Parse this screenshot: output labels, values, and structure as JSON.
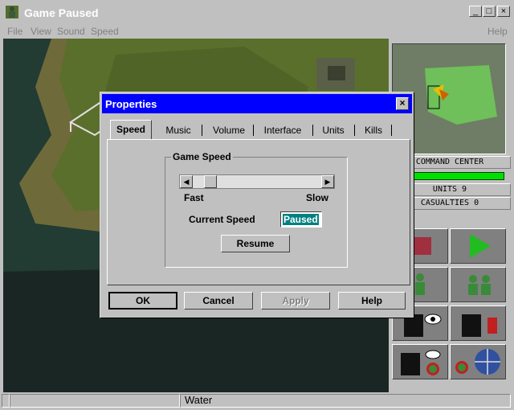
{
  "window": {
    "title": "Game Paused",
    "controls": {
      "minimize": "_",
      "maximize": "□",
      "close": "×"
    }
  },
  "menu": {
    "items": [
      "File",
      "View",
      "Sound",
      "Speed"
    ],
    "help": "Help"
  },
  "dialog": {
    "title": "Properties",
    "close": "×",
    "tabs": [
      "Speed",
      "Music",
      "Volume",
      "Interface",
      "Units",
      "Kills"
    ],
    "active_tab": "Speed",
    "group_title": "Game Speed",
    "slider": {
      "left_label": "Fast",
      "right_label": "Slow",
      "left_arrow": "◀",
      "right_arrow": "▶",
      "position": 0.1
    },
    "current_speed_label": "Current Speed",
    "current_speed_value": "Paused",
    "resume_label": "Resume",
    "buttons": {
      "ok": "OK",
      "cancel": "Cancel",
      "apply": "Apply",
      "help": "Help"
    }
  },
  "side_panel": {
    "command_center": "COMMAND CENTER",
    "units": "UNITS 9",
    "casualties": "CASUALTIES 0"
  },
  "status_bar": {
    "terrain": "Water"
  },
  "colors": {
    "dialog_title": "#0000ff",
    "selected_text": "#008080",
    "health": "#00e000",
    "play_icon": "#22bb22"
  }
}
